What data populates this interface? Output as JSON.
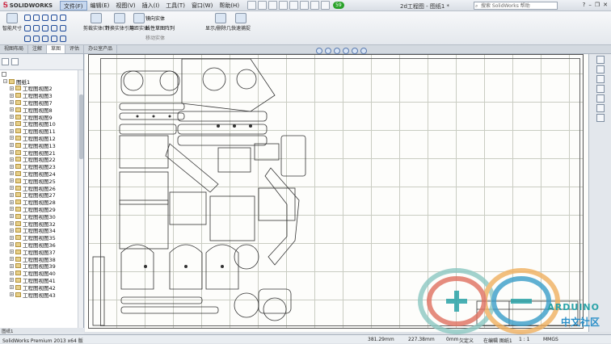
{
  "app": {
    "logo_text": "SOLIDWORKS",
    "title": "2d工程图 - 图纸1 *"
  },
  "menu": [
    "文件(F)",
    "编辑(E)",
    "视图(V)",
    "插入(I)",
    "工具(T)",
    "窗口(W)",
    "帮助(H)"
  ],
  "badge": "59",
  "search": {
    "placeholder": "搜索 SolidWorks 帮助"
  },
  "ribbon": {
    "groups": [
      {
        "label": "智能尺寸"
      },
      {
        "label": "剪裁实体(T)"
      },
      {
        "label": "转换实体引用"
      },
      {
        "label": "等距实体"
      },
      {
        "label": "显示/删除几..."
      },
      {
        "label": "快速捕捉"
      }
    ],
    "mirror_label": "镜向实体",
    "linear_pattern_label": "线性草图阵列",
    "move_label": "移动实体"
  },
  "tabs": [
    "视图布局",
    "注解",
    "草图",
    "评估",
    "办公室产品"
  ],
  "active_tab_index": 2,
  "tree": {
    "root": "图纸1",
    "items": [
      "工程图视图2",
      "工程图视图3",
      "工程图视图7",
      "工程图视图8",
      "工程图视图9",
      "工程图视图10",
      "工程图视图11",
      "工程图视图12",
      "工程图视图13",
      "工程图视图21",
      "工程图视图22",
      "工程图视图23",
      "工程图视图24",
      "工程图视图25",
      "工程图视图26",
      "工程图视图27",
      "工程图视图28",
      "工程图视图29",
      "工程图视图30",
      "工程图视图32",
      "工程图视图34",
      "工程图视图35",
      "工程图视图36",
      "工程图视图37",
      "工程图视图38",
      "工程图视图39",
      "工程图视图40",
      "工程图视图41",
      "工程图视图42",
      "工程图视图43"
    ]
  },
  "sheet_tab": "图纸1",
  "status": {
    "product": "SolidWorks Premium 2013 x64 版",
    "x": "381.29mm",
    "y": "227.38mm",
    "z": "0mm",
    "state": "欠定义",
    "editing": "在编辑 图纸1",
    "scale": "1 : 1",
    "units": "MMGS"
  },
  "watermark": {
    "line1": "ARDUINO",
    "line2": "中文社区"
  },
  "colors": {
    "brand": "#c8102e",
    "accent": "#2aa3a8",
    "menu_active": "#c6d7ee"
  }
}
